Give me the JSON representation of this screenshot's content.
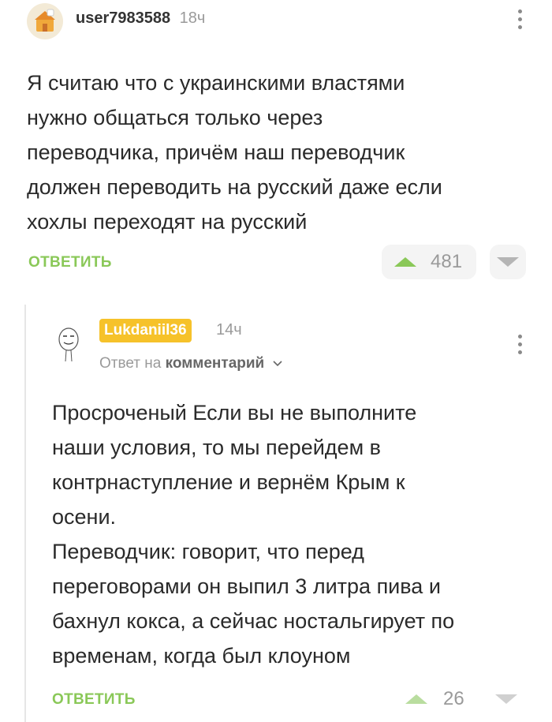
{
  "comment1": {
    "username": "user7983588",
    "time": "18ч",
    "text": "Я считаю что с украинскими властями\nнужно общаться только через\nпереводчика, причём наш переводчик\nдолжен переводить на русский даже если\nхохлы переходят на русский",
    "reply_label": "ОТВЕТИТЬ",
    "score": "481"
  },
  "comment2": {
    "username": "Lukdaniil36",
    "time": "14ч",
    "reply_to_prefix": "Ответ на",
    "reply_to_target": "комментарий",
    "text": "Просроченый Если вы не выполните\nнаши условия, то мы перейдем в\nконтрнаступление и вернём Крым к\nосени.\nПереводчик: говорит, что перед\nпереговорами он выпил 3 литра пива и\nбахнул кокса, а сейчас ностальгирует по\nвременам, когда был клоуном",
    "reply_label": "ОТВЕТИТЬ",
    "score": "26"
  },
  "colors": {
    "accent_green": "#8ac858",
    "badge_yellow": "#f6c22a",
    "muted_gray": "#9a9a9a"
  },
  "icons": [
    "avatar-house-icon",
    "avatar-face-icon",
    "more-vertical-icon",
    "upvote-icon",
    "downvote-icon",
    "chevron-down-icon"
  ]
}
